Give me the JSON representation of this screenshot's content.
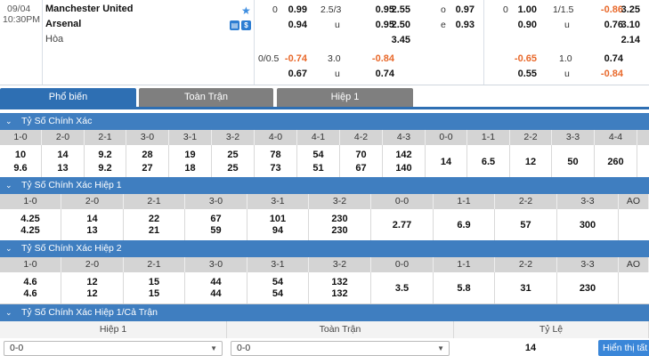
{
  "match": {
    "date": "09/04",
    "time": "10:30PM",
    "home": "Manchester United",
    "away": "Arsenal",
    "draw_label": "Hòa",
    "icons": [
      "star-icon",
      "tv-icon",
      "dollar-icon"
    ],
    "ft": {
      "hcap_line": "0",
      "hcap_home": "0.99",
      "hcap_away": "0.94",
      "ou_line": "2.5/3",
      "ou_over": "0.95",
      "ou_label_u": "u",
      "ou_under": "0.95",
      "x12_home": "2.55",
      "x12_away": "2.50",
      "x12_draw": "3.45",
      "oe_label_o": "o",
      "oe_label_e": "e",
      "oe_odd": "0.97",
      "oe_even": "0.93",
      "hcap2_line": "0/0.5",
      "hcap2_home": "-0.74",
      "hcap2_away": "0.67",
      "ou2_line": "3.0",
      "ou2_over": "-0.84",
      "ou2_label_u": "u",
      "ou2_under": "0.74"
    },
    "h1": {
      "hcap_line": "0",
      "hcap_home": "1.00",
      "hcap_away": "0.90",
      "ou_line": "1/1.5",
      "ou_over": "-0.86",
      "ou_label_u": "u",
      "ou_under": "0.76",
      "x12_home": "3.25",
      "x12_away": "3.10",
      "x12_draw": "2.14",
      "hcap2_home": "-0.65",
      "hcap2_away": "0.55",
      "ou2_line": "1.0",
      "ou2_over": "0.74",
      "ou2_label_u": "u",
      "ou2_under": "-0.84"
    }
  },
  "tabs": [
    {
      "label": "Phổ biến",
      "active": true
    },
    {
      "label": "Toàn Trận",
      "active": false
    },
    {
      "label": "Hiệp 1",
      "active": false
    }
  ],
  "sections": [
    {
      "title": "Tỷ Số Chính Xác",
      "headers": [
        "1-0",
        "2-0",
        "2-1",
        "3-0",
        "3-1",
        "3-2",
        "4-0",
        "4-1",
        "4-2",
        "4-3",
        "0-0",
        "1-1",
        "2-2",
        "3-3",
        "4-4"
      ],
      "top": [
        "10",
        "14",
        "9.2",
        "28",
        "19",
        "25",
        "78",
        "54",
        "70",
        "142"
      ],
      "bottom": [
        "9.6",
        "13",
        "9.2",
        "27",
        "18",
        "25",
        "73",
        "51",
        "67",
        "140"
      ],
      "single": [
        "14",
        "6.5",
        "12",
        "50",
        "260"
      ]
    },
    {
      "title": "Tỷ Số Chính Xác Hiệp 1",
      "headers": [
        "1-0",
        "2-0",
        "2-1",
        "3-0",
        "3-1",
        "3-2",
        "0-0",
        "1-1",
        "2-2",
        "3-3",
        "AO"
      ],
      "top": [
        "4.25",
        "14",
        "22",
        "67",
        "101",
        "230"
      ],
      "bottom": [
        "4.25",
        "13",
        "21",
        "59",
        "94",
        "230"
      ],
      "single": [
        "2.77",
        "6.9",
        "57",
        "300"
      ]
    },
    {
      "title": "Tỷ Số Chính Xác Hiệp 2",
      "headers": [
        "1-0",
        "2-0",
        "2-1",
        "3-0",
        "3-1",
        "3-2",
        "0-0",
        "1-1",
        "2-2",
        "3-3",
        "AO"
      ],
      "top": [
        "4.6",
        "12",
        "15",
        "44",
        "54",
        "132"
      ],
      "bottom": [
        "4.6",
        "12",
        "15",
        "44",
        "54",
        "132"
      ],
      "single": [
        "3.5",
        "5.8",
        "31",
        "230"
      ]
    }
  ],
  "htft": {
    "title": "Tỷ Số Chính Xác Hiệp 1/Cả Trận",
    "col1": "Hiệp 1",
    "col2": "Toàn Trận",
    "col3": "Tỷ Lệ",
    "sel1": "0-0",
    "sel2": "0-0",
    "ratio": "14",
    "button": "Hiển thị tất cả"
  }
}
